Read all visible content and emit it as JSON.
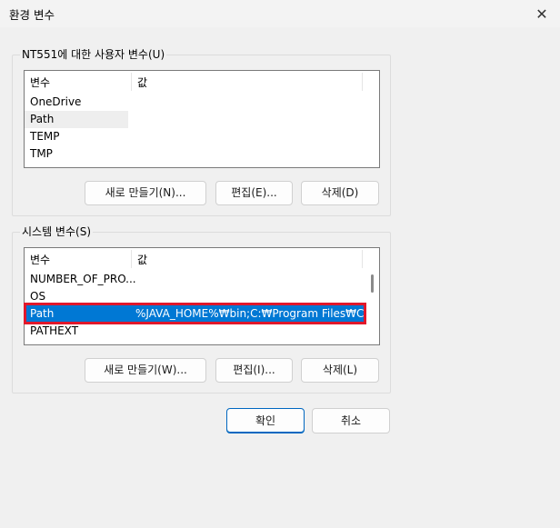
{
  "window": {
    "title": "환경 변수",
    "close_glyph": "✕"
  },
  "user_vars": {
    "group_label": "NT551에 대한 사용자 변수(U)",
    "columns": [
      "변수",
      "값"
    ],
    "rows": [
      {
        "name": "OneDrive",
        "value": ""
      },
      {
        "name": "Path",
        "value": ""
      },
      {
        "name": "TEMP",
        "value": ""
      },
      {
        "name": "TMP",
        "value": ""
      }
    ],
    "buttons": {
      "new": "새로 만들기(N)...",
      "edit": "편집(E)...",
      "delete": "삭제(D)"
    }
  },
  "system_vars": {
    "group_label": "시스템 변수(S)",
    "columns": [
      "변수",
      "값"
    ],
    "rows": [
      {
        "name": "NUMBER_OF_PRO...",
        "value": ""
      },
      {
        "name": "OS",
        "value": ""
      },
      {
        "name": "Path",
        "value": "%JAVA_HOME%₩bin;C:₩Program Files₩Co..."
      },
      {
        "name": "PATHEXT",
        "value": ""
      }
    ],
    "buttons": {
      "new": "새로 만들기(W)...",
      "edit": "편집(I)...",
      "delete": "삭제(L)"
    }
  },
  "footer": {
    "ok": "확인",
    "cancel": "취소"
  },
  "colors": {
    "selection": "#0078d4",
    "highlight_box": "#e1182b"
  }
}
